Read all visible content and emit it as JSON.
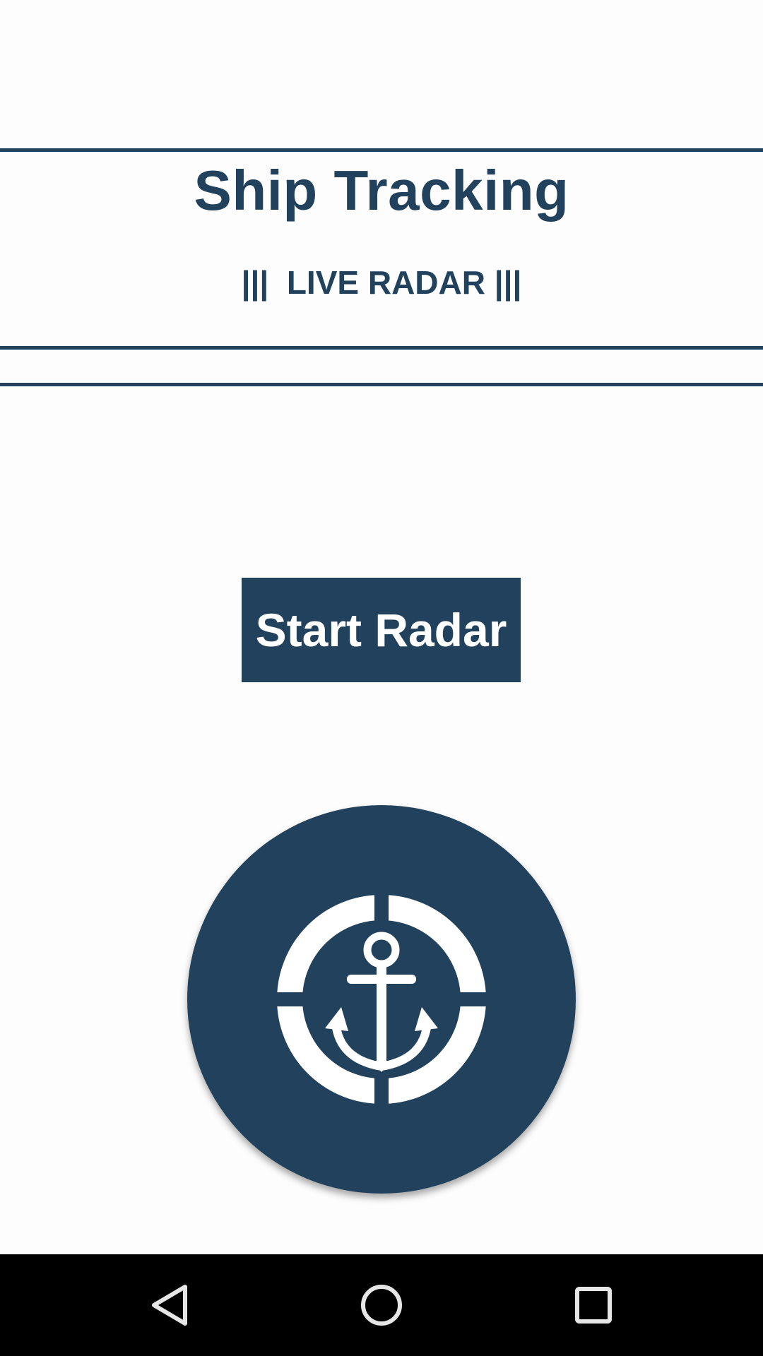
{
  "header": {
    "title": "Ship Tracking",
    "subtitle": "|||  LIVE RADAR |||"
  },
  "main": {
    "start_button_label": "Start Radar"
  },
  "logo": {
    "icon": "anchor-lifebuoy-icon"
  },
  "navbar": {
    "back_icon": "back-triangle-icon",
    "home_icon": "home-circle-icon",
    "recents_icon": "recents-square-icon"
  },
  "colors": {
    "primary": "#21415c",
    "background": "#fdfdfd",
    "navbar": "#000000",
    "on_primary": "#ffffff"
  }
}
